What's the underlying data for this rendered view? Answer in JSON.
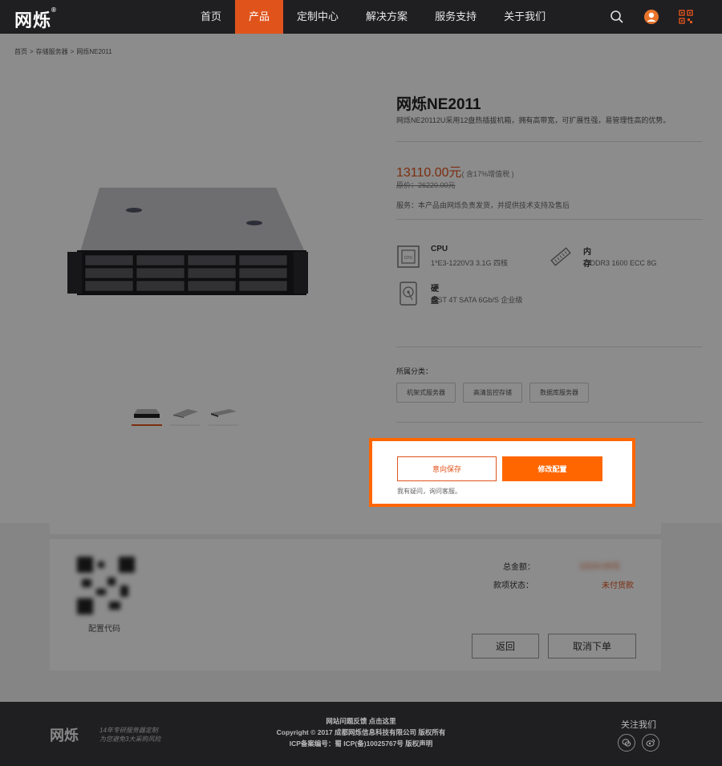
{
  "header": {
    "logo": "网烁",
    "logo_mark": "®",
    "nav": [
      "首页",
      "产品",
      "定制中心",
      "解决方案",
      "服务支持",
      "关于我们"
    ],
    "active_nav": 1
  },
  "breadcrumb": [
    "首页",
    "存储服务器",
    "网烁NE2011"
  ],
  "breadcrumb_sep": ">",
  "product": {
    "title": "网烁NE2011",
    "description": "网烁NE20112U采用12盘热插拔机箱，拥有高带宽，可扩展性强，易管理性高的优势。",
    "price": "13110.00元",
    "price_note": "( 含17%增值税 )",
    "original_price": "原价：26220.00元",
    "service": "服务：本产品由网烁负责发货，并提供技术支持及售后",
    "specs": [
      {
        "name": "CPU",
        "value": "1*E3-1220V3 3.1G 四核",
        "icon": "cpu-icon"
      },
      {
        "name": "内存",
        "value": "1*DDR3 1600 ECC 8G",
        "icon": "memory-icon"
      },
      {
        "name": "硬盘",
        "value": "3*ST 4T SATA 6Gb/S 企业级",
        "icon": "hdd-icon"
      }
    ],
    "category_label": "所属分类：",
    "tags": [
      "机架式服务器",
      "高清监控存储",
      "数据库服务器"
    ]
  },
  "actions": {
    "save": "意向保存",
    "modify": "修改配置",
    "ask": "我有疑问，询问客服。"
  },
  "order": {
    "qr_label": "配置代码",
    "total_label": "总金额：",
    "total_value": "13110.00元",
    "pay_label": "款项状态：",
    "pay_value": "未付货款",
    "back": "返回",
    "cancel": "取消下单"
  },
  "footer": {
    "logo": "网烁",
    "slogan_1": "14年专研服务器定制",
    "slogan_2": "为您避免3大采购风险",
    "line1": "网站问题反馈 点击这里",
    "line2": "Copyright © 2017 成都网烁信息科技有限公司 版权所有",
    "line3": "ICP备案编号：蜀 ICP(备)10025767号   版权声明",
    "follow": "关注我们"
  },
  "colors": {
    "accent": "#ff6600",
    "brand": "#e0541c",
    "dark": "#1f1f22"
  }
}
